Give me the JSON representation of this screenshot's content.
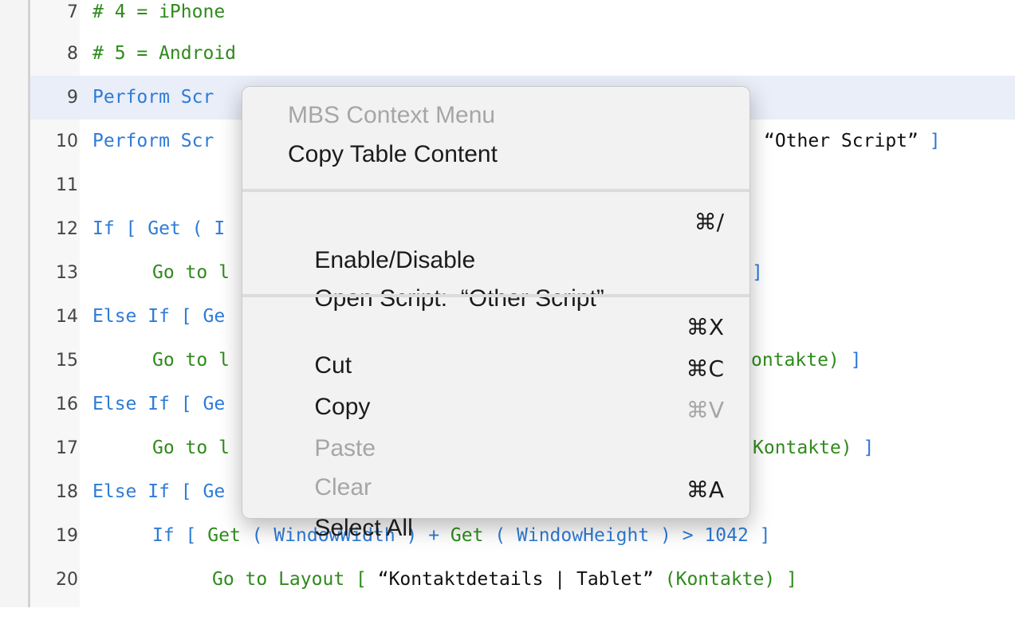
{
  "editor": {
    "lines": [
      {
        "num": "7",
        "code": "# 4 = iPhone"
      },
      {
        "num": "8",
        "code": "# 5 = Android"
      },
      {
        "num": "9",
        "code": "Perform Scr"
      },
      {
        "num": "10",
        "code": "Perform Scr",
        "tail": "“Other Script”",
        "tail_bracket": "]"
      },
      {
        "num": "11",
        "code": ""
      },
      {
        "num": "12",
        "code": "If [ Get ( I"
      },
      {
        "num": "13",
        "code": "Go to l",
        "tail_bracket": "]"
      },
      {
        "num": "14",
        "code": "Else If [ Ge"
      },
      {
        "num": "15",
        "code": "Go to l",
        "tail": "ontakte)",
        "tail_bracket": "]"
      },
      {
        "num": "16",
        "code": "Else If [ Ge"
      },
      {
        "num": "17",
        "code": "Go to l",
        "tail": "Kontakte)",
        "tail_bracket": "]"
      },
      {
        "num": "18",
        "code": "Else If [ Ge"
      },
      {
        "num": "19",
        "code_parts": [
          "If [ ",
          "Get",
          " ( ",
          "WindowWidth",
          " ) + ",
          "Get",
          " ( ",
          "WindowHeight",
          " ) > 1042 ]"
        ]
      },
      {
        "num": "20",
        "code_parts": [
          "Go to Layout [ ",
          "“Kontaktdetails | Tablet”",
          " (Kontakte) ]"
        ]
      }
    ]
  },
  "context_menu": {
    "header": "MBS Context Menu",
    "copy_table": "Copy Table Content",
    "enable_disable": {
      "label": "Enable/Disable",
      "shortcut": "⌘/"
    },
    "open_script": {
      "label": "Open Script:  “Other Script”"
    },
    "cut": {
      "label": "Cut",
      "shortcut": "⌘X"
    },
    "copy": {
      "label": "Copy",
      "shortcut": "⌘C"
    },
    "paste": {
      "label": "Paste",
      "shortcut": "⌘V"
    },
    "clear": {
      "label": "Clear"
    },
    "select_all": {
      "label": "Select All",
      "shortcut": "⌘A"
    }
  }
}
